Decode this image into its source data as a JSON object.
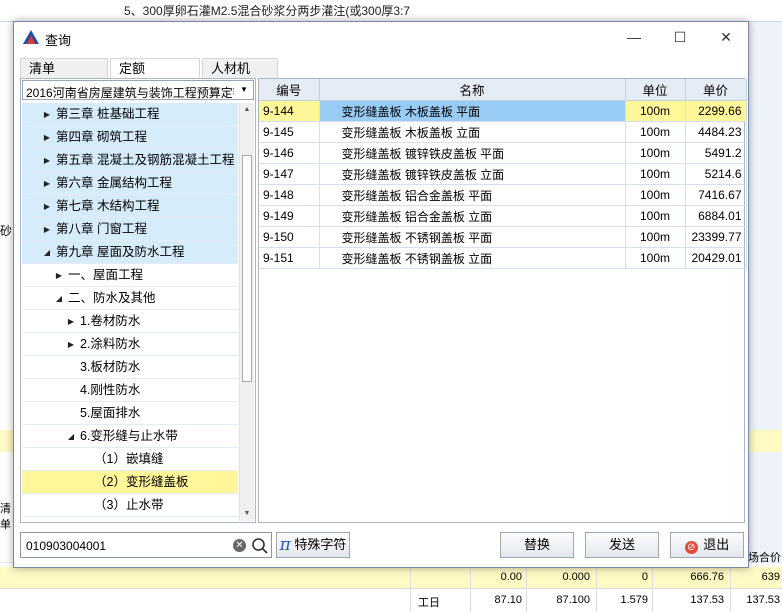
{
  "background": {
    "top_line1": "5、300厚卵石灌M2.5混合砂浆分两步灌注(或300厚3:7",
    "left_label1": "砂",
    "left_label2": "清单",
    "right_label": "场合价",
    "row1_values": [
      "0.00",
      "0.000",
      "0",
      "666.76",
      "639"
    ],
    "row2_values": [
      "工日",
      "87.10",
      "87.100",
      "1.579",
      "137.53",
      "137.53"
    ]
  },
  "dialog": {
    "title": "查询",
    "minimize": "—",
    "maximize": "☐",
    "close": "✕"
  },
  "tabs": [
    "清单",
    "定额",
    "人材机"
  ],
  "active_tab": 1,
  "quota_library": "2016河南省房屋建筑与装饰工程预算定额",
  "tree": [
    {
      "label": "第三章 桩基础工程",
      "level": 1,
      "toggle": "right",
      "style": "blue"
    },
    {
      "label": "第四章 砌筑工程",
      "level": 1,
      "toggle": "right",
      "style": "blue"
    },
    {
      "label": "第五章 混凝土及钢筋混凝土工程",
      "level": 1,
      "toggle": "right",
      "style": "blue"
    },
    {
      "label": "第六章 金属结构工程",
      "level": 1,
      "toggle": "right",
      "style": "blue"
    },
    {
      "label": "第七章 木结构工程",
      "level": 1,
      "toggle": "right",
      "style": "blue"
    },
    {
      "label": "第八章 门窗工程",
      "level": 1,
      "toggle": "right",
      "style": "blue"
    },
    {
      "label": "第九章 屋面及防水工程",
      "level": 1,
      "toggle": "down",
      "style": "blue"
    },
    {
      "label": "一、屋面工程",
      "level": 2,
      "toggle": "right",
      "style": "white"
    },
    {
      "label": "二、防水及其他",
      "level": 2,
      "toggle": "down",
      "style": "white"
    },
    {
      "label": "1.卷材防水",
      "level": 3,
      "toggle": "right",
      "style": "white"
    },
    {
      "label": "2.涂料防水",
      "level": 3,
      "toggle": "right",
      "style": "white"
    },
    {
      "label": "3.板材防水",
      "level": 3,
      "toggle": "none",
      "style": "white"
    },
    {
      "label": "4.刚性防水",
      "level": 3,
      "toggle": "none",
      "style": "white"
    },
    {
      "label": "5.屋面排水",
      "level": 3,
      "toggle": "none",
      "style": "white"
    },
    {
      "label": "6.变形缝与止水带",
      "level": 3,
      "toggle": "down",
      "style": "white"
    },
    {
      "label": "（1）嵌填缝",
      "level": 4,
      "toggle": "none",
      "style": "white"
    },
    {
      "label": "（2）变形缝盖板",
      "level": 4,
      "toggle": "none",
      "style": "yellow"
    },
    {
      "label": "（3）止水带",
      "level": 4,
      "toggle": "none",
      "style": "white"
    }
  ],
  "grid": {
    "headers": [
      "编号",
      "名称",
      "单位",
      "单价"
    ],
    "rows": [
      [
        "9-144",
        "变形缝盖板 木板盖板 平面",
        "100m",
        "2299.66"
      ],
      [
        "9-145",
        "变形缝盖板 木板盖板 立面",
        "100m",
        "4484.23"
      ],
      [
        "9-146",
        "变形缝盖板 镀锌铁皮盖板 平面",
        "100m",
        "5491.2"
      ],
      [
        "9-147",
        "变形缝盖板 镀锌铁皮盖板 立面",
        "100m",
        "5214.6"
      ],
      [
        "9-148",
        "变形缝盖板 铝合金盖板 平面",
        "100m",
        "7416.67"
      ],
      [
        "9-149",
        "变形缝盖板 铝合金盖板 立面",
        "100m",
        "6884.01"
      ],
      [
        "9-150",
        "变形缝盖板 不锈钢盖板 平面",
        "100m",
        "23399.77"
      ],
      [
        "9-151",
        "变形缝盖板 不锈钢盖板 立面",
        "100m",
        "20429.01"
      ]
    ],
    "selected_row": 0
  },
  "search": {
    "value": "010903004001"
  },
  "buttons": {
    "special_chars": "特殊字符",
    "replace": "替换",
    "send": "发送",
    "exit": "退出"
  },
  "colors": {
    "selection_blue": "#99ccf5",
    "highlight_yellow": "#fff79a",
    "tree_blue": "#d6ecfa",
    "pi_blue": "#1c5fc8",
    "exit_red": "#e24a3a"
  }
}
